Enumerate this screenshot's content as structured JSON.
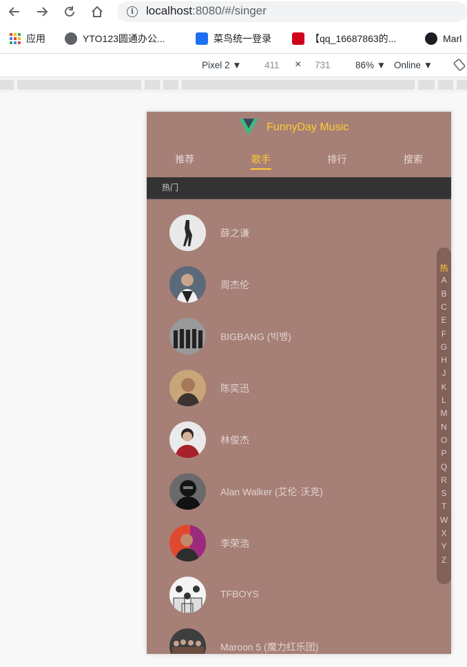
{
  "browser": {
    "url_host": "localhost",
    "url_rest": ":8080/#/singer",
    "bookmarks": [
      {
        "label": "应用",
        "icon": "apps-grid-icon"
      },
      {
        "label": "YTO123圆通办公...",
        "icon": "globe-icon"
      },
      {
        "label": "菜鸟统一登录",
        "icon": "cainiao-icon"
      },
      {
        "label": "【qq_16687863的...",
        "icon": "csdn-icon"
      },
      {
        "label": "Marl",
        "icon": "github-icon"
      }
    ],
    "device": {
      "name": "Pixel 2",
      "width": "411",
      "times": "×",
      "height": "731",
      "zoom": "86%",
      "network": "Online"
    }
  },
  "app": {
    "title": "FunnyDay Music",
    "tabs": [
      "推荐",
      "歌手",
      "排行",
      "搜索"
    ],
    "active_tab": "歌手",
    "group_title": "热门",
    "singers": [
      "薛之谦",
      "周杰伦",
      "BIGBANG (빅뱅)",
      "陈奕迅",
      "林俊杰",
      "Alan Walker (艾伦·沃克)",
      "李荣浩",
      "TFBOYS",
      "Maroon 5 (魔力红乐团)"
    ],
    "shortcut": [
      "热",
      "A",
      "B",
      "C",
      "E",
      "F",
      "G",
      "H",
      "J",
      "K",
      "L",
      "M",
      "N",
      "O",
      "P",
      "Q",
      "R",
      "S",
      "T",
      "W",
      "X",
      "Y",
      "Z"
    ],
    "shortcut_active": "热"
  },
  "colors": {
    "accent": "#ffcd32",
    "background": "#a67f77",
    "group_bar": "#333333"
  }
}
